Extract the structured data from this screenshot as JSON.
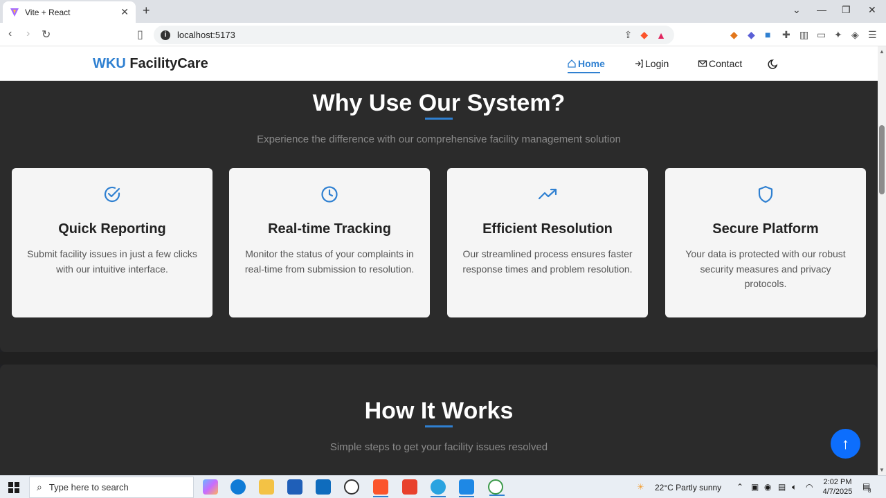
{
  "browser": {
    "tab_title": "Vite + React",
    "url": "localhost:5173",
    "new_tab": "+",
    "close_tab": "✕"
  },
  "site": {
    "logo_accent": "WKU",
    "logo_rest": " FacilityCare",
    "nav": [
      {
        "label": "Home",
        "icon": "home-icon",
        "active": true
      },
      {
        "label": "Login",
        "icon": "login-icon",
        "active": false
      },
      {
        "label": "Contact",
        "icon": "mail-icon",
        "active": false
      }
    ],
    "theme_toggle_icon": "moon-icon"
  },
  "why": {
    "title": "Why Use Our System?",
    "subtitle": "Experience the difference with our comprehensive facility management solution",
    "cards": [
      {
        "icon": "check-circle-icon",
        "title": "Quick Reporting",
        "text": "Submit facility issues in just a few clicks with our intuitive interface."
      },
      {
        "icon": "clock-icon",
        "title": "Real-time Tracking",
        "text": "Monitor the status of your complaints in real-time from submission to resolution."
      },
      {
        "icon": "trending-up-icon",
        "title": "Efficient Resolution",
        "text": "Our streamlined process ensures faster response times and problem resolution."
      },
      {
        "icon": "shield-icon",
        "title": "Secure Platform",
        "text": "Your data is protected with our robust security measures and privacy protocols."
      }
    ]
  },
  "how": {
    "title": "How It Works",
    "subtitle": "Simple steps to get your facility issues resolved"
  },
  "taskbar": {
    "search_placeholder": "Type here to search",
    "weather": "22°C  Partly sunny",
    "time": "2:02 PM",
    "date": "4/7/2025",
    "notification_count": "8"
  },
  "colors": {
    "accent": "#2f80d1",
    "section_bg": "#2b2b2b",
    "card_bg": "#f5f5f5",
    "fab": "#0d6efd"
  }
}
